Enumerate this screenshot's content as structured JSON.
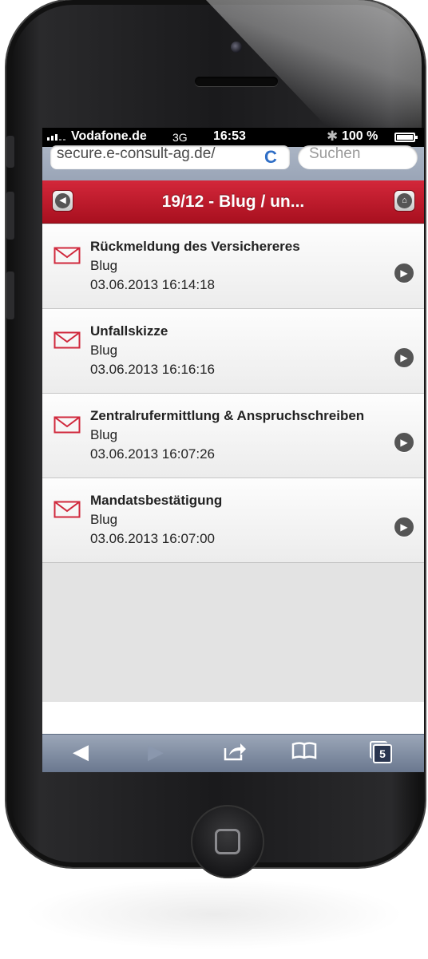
{
  "status_bar": {
    "carrier": "Vodafone.de",
    "network": "3G",
    "time": "16:53",
    "battery": "100 %"
  },
  "browser": {
    "url": "secure.e-consult-ag.de/",
    "search_placeholder": "Suchen",
    "tab_count": "5"
  },
  "header": {
    "title": "19/12 - Blug / un..."
  },
  "messages": [
    {
      "subject": "Rückmeldung des Versichereres",
      "sender": "Blug",
      "date": "03.06.2013 16:14:18"
    },
    {
      "subject": "Unfallskizze",
      "sender": "Blug",
      "date": "03.06.2013 16:16:16"
    },
    {
      "subject": "Zentralrufermittlung & Anspruchschreiben",
      "sender": "Blug",
      "date": "03.06.2013 16:07:26"
    },
    {
      "subject": "Mandatsbestätigung",
      "sender": "Blug",
      "date": "03.06.2013 16:07:00"
    }
  ],
  "colors": {
    "header_red": "#c41e30",
    "envelope_red": "#d0283c",
    "toolbar_blue": "#7a889e"
  },
  "icons": {
    "back": "chevron-left-icon",
    "home": "home-icon",
    "envelope": "envelope-icon",
    "row_arrow": "chevron-right-icon",
    "share": "share-icon",
    "bookmarks": "bookmarks-icon",
    "tabs": "tabs-icon"
  }
}
